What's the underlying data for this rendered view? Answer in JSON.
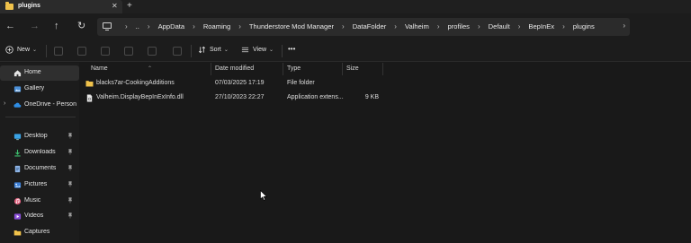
{
  "tab": {
    "title": "plugins",
    "close_icon": "close-icon",
    "new_tab_label": "+"
  },
  "nav": {
    "back": "←",
    "forward": "→",
    "up": "↑",
    "refresh": "↻"
  },
  "address": {
    "ellipsis": "..",
    "crumbs": [
      "AppData",
      "Roaming",
      "Thunderstore Mod Manager",
      "DataFolder",
      "Valheim",
      "profiles",
      "Default",
      "BepInEx",
      "plugins"
    ],
    "separator": "›",
    "dropdown": "›"
  },
  "commands": {
    "new_label": "New",
    "sort_label": "Sort",
    "view_label": "View",
    "more_label": "•••"
  },
  "sidebar": {
    "items": [
      {
        "label": "Home",
        "icon": "home-icon",
        "selected": true
      },
      {
        "label": "Gallery",
        "icon": "gallery-icon"
      },
      {
        "label": "OneDrive - Persona",
        "icon": "cloud-icon",
        "expandable": true
      },
      {
        "label": "Desktop",
        "icon": "desktop-icon",
        "pinned": true
      },
      {
        "label": "Downloads",
        "icon": "downloads-icon",
        "pinned": true
      },
      {
        "label": "Documents",
        "icon": "documents-icon",
        "pinned": true
      },
      {
        "label": "Pictures",
        "icon": "pictures-icon",
        "pinned": true
      },
      {
        "label": "Music",
        "icon": "music-icon",
        "pinned": true
      },
      {
        "label": "Videos",
        "icon": "videos-icon",
        "pinned": true
      },
      {
        "label": "Captures",
        "icon": "folder-icon"
      }
    ],
    "pin_glyph": "📌"
  },
  "columns": {
    "name": "Name",
    "date": "Date modified",
    "type": "Type",
    "size": "Size"
  },
  "files": [
    {
      "name": "blacks7ar-CookingAdditions",
      "date": "07/03/2025 17:19",
      "type": "File folder",
      "size": "",
      "icon": "folder-icon"
    },
    {
      "name": "Valheim.DisplayBepInExInfo.dll",
      "date": "27/10/2023 22:27",
      "type": "Application extens...",
      "size": "9 KB",
      "icon": "dll-file-icon"
    }
  ],
  "colors": {
    "folder": "#f0c24b",
    "accent": "#4cc2ff",
    "background": "#191919"
  }
}
